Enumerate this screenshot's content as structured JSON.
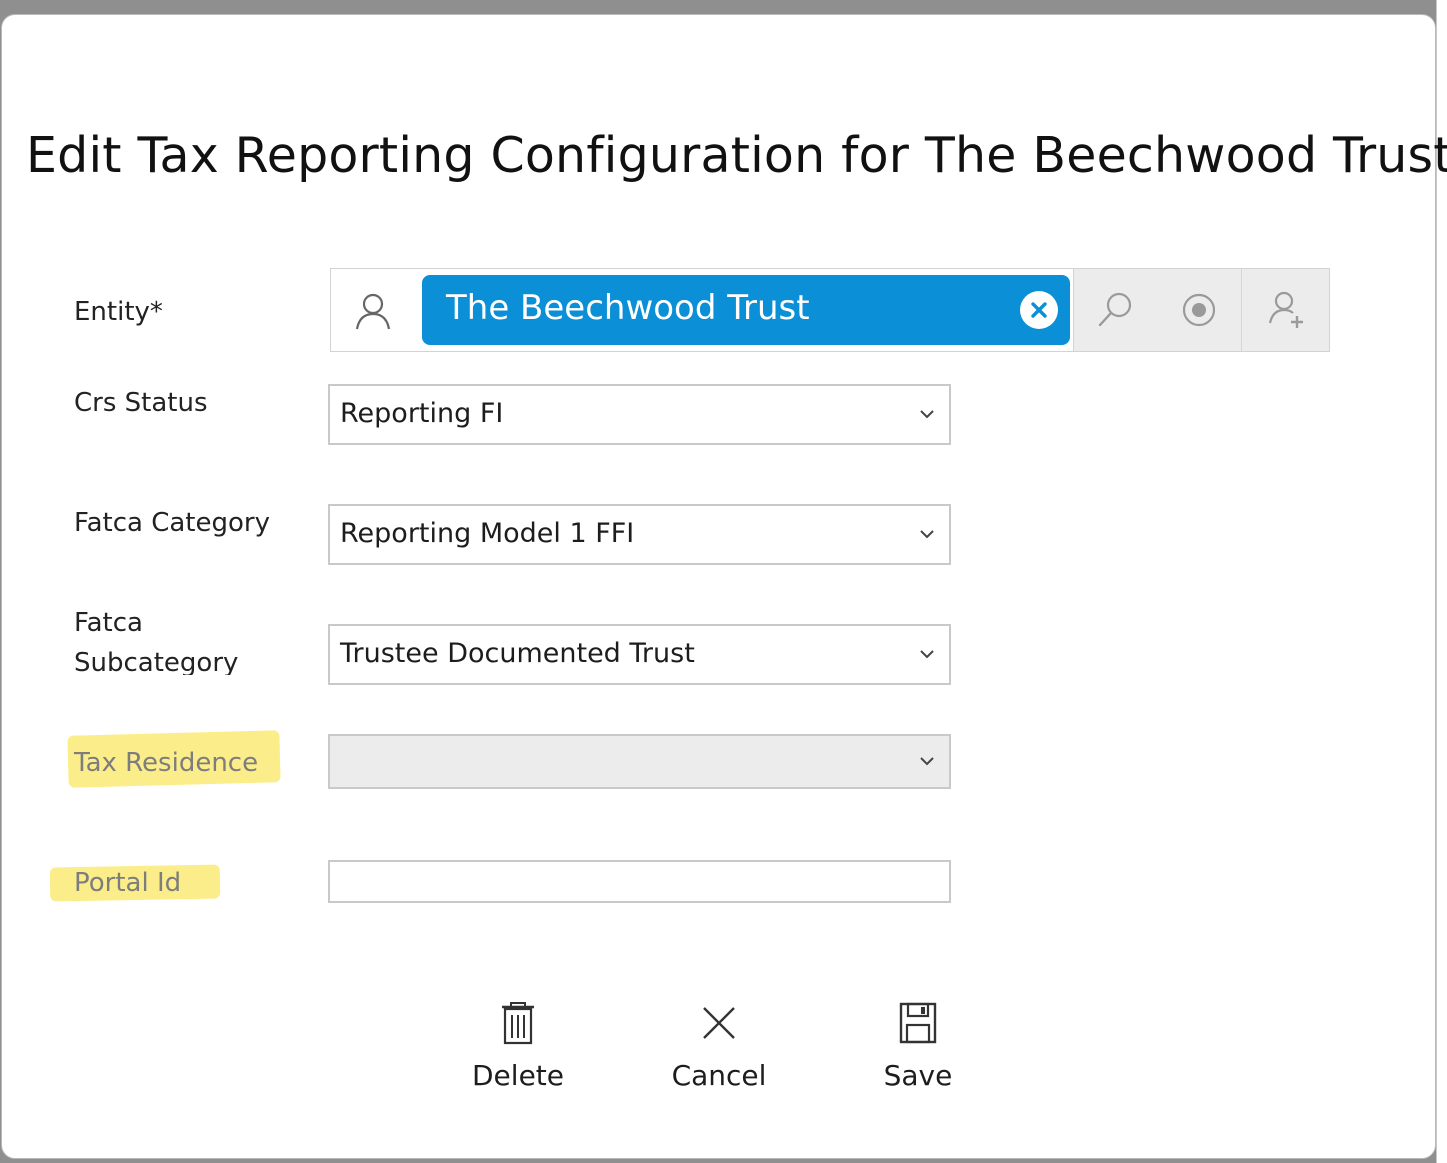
{
  "dialog": {
    "title": "Edit Tax Reporting Configuration for The Beechwood Trust"
  },
  "entity": {
    "label": "Entity*",
    "value": "The Beechwood Trust",
    "icons": [
      "person-icon",
      "clear-icon",
      "search-icon",
      "target-icon",
      "add-person-icon"
    ]
  },
  "crs_status": {
    "label": "Crs Status",
    "value": "Reporting FI"
  },
  "fatca_category": {
    "label": "Fatca Category",
    "value": "Reporting Model 1 FFI"
  },
  "fatca_subcategory": {
    "label_line1": "Fatca",
    "label_line2": "Subcategory",
    "value": "Trustee Documented Trust"
  },
  "tax_residence": {
    "label": "Tax Residence",
    "value": ""
  },
  "portal_id": {
    "label": "Portal Id",
    "value": ""
  },
  "actions": {
    "delete_label": "Delete",
    "cancel_label": "Cancel",
    "save_label": "Save"
  },
  "colors": {
    "accent": "#0b8fd6",
    "highlight": "#fbee8a"
  }
}
